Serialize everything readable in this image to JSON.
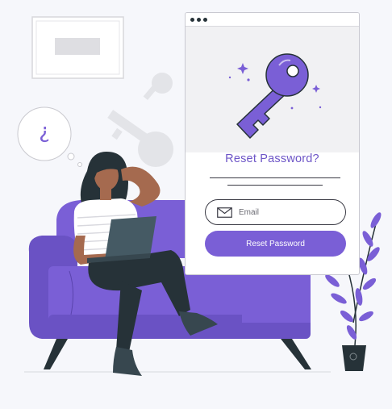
{
  "form": {
    "title": "Reset Password?",
    "email_placeholder": "Email",
    "email_value": "",
    "submit_label": "Reset Password"
  },
  "thought_bubble": {
    "symbol": "¿"
  },
  "icons": {
    "mail": "envelope-icon",
    "key": "key-icon",
    "window_controls": "three-dots-icon"
  },
  "colors": {
    "accent": "#7a5fd6",
    "accent_text": "#6d55c7",
    "dark": "#263238",
    "background": "#f6f7fb"
  }
}
